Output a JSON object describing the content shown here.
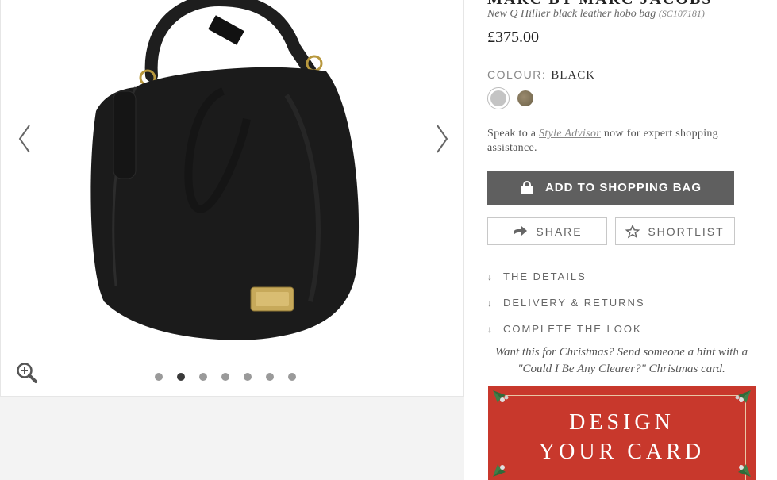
{
  "gallery": {
    "prev_label": "previous image",
    "next_label": "next image",
    "image_count": 7,
    "active_index": 1
  },
  "product": {
    "brand": "MARC BY MARC JACOBS",
    "name": "New Q Hillier black leather hobo bag",
    "code": "(SC107181)",
    "price": "£375.00"
  },
  "colour": {
    "label": "COLOUR:",
    "value": "BLACK",
    "swatches": [
      "selected",
      "taupe"
    ]
  },
  "advisor": {
    "prefix": "Speak to a ",
    "link": "Style Advisor",
    "suffix": " now for expert shopping assistance."
  },
  "actions": {
    "add_to_bag": "ADD TO SHOPPING BAG",
    "share": "SHARE",
    "shortlist": "SHORTLIST"
  },
  "accordion": [
    {
      "label": "THE DETAILS"
    },
    {
      "label": "DELIVERY & RETURNS"
    },
    {
      "label": "COMPLETE THE LOOK"
    }
  ],
  "christmas": {
    "message": "Want this for Christmas? Send someone a hint with a \"Could I Be Any Clearer?\" Christmas card.",
    "banner_line1": "DESIGN",
    "banner_line2": "YOUR CARD"
  },
  "colors": {
    "button_bg": "#5f5f5f",
    "banner_red": "#c8382c",
    "dot_active": "#3a3a3a",
    "dot_inactive": "#9a9a9a"
  }
}
